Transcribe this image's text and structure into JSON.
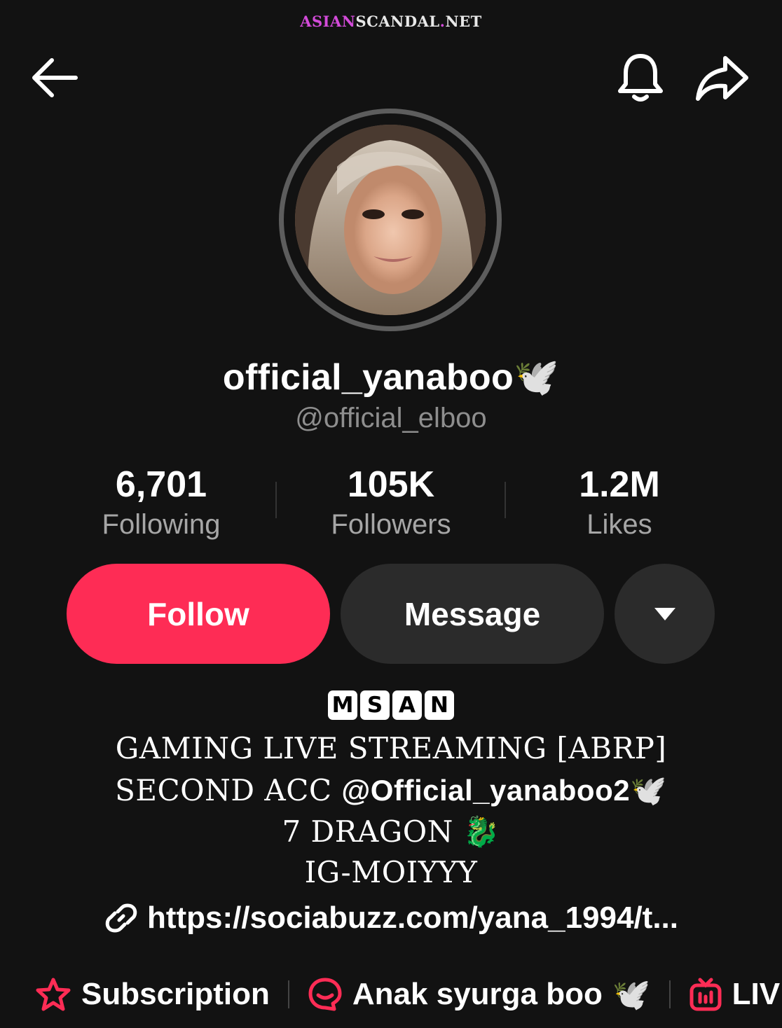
{
  "watermark": {
    "part1": "ASIAN",
    "part2": "SCANDAL",
    "dot": ".",
    "part3": "NET"
  },
  "header": {
    "icons": [
      "back-arrow-icon",
      "bell-icon",
      "share-icon"
    ]
  },
  "profile": {
    "display_name": "official_yanaboo",
    "display_emoji": "🕊️",
    "username": "@official_elboo"
  },
  "stats": [
    {
      "value": "6,701",
      "label": "Following"
    },
    {
      "value": "105K",
      "label": "Followers"
    },
    {
      "value": "1.2M",
      "label": "Likes"
    }
  ],
  "actions": {
    "follow": "Follow",
    "message": "Message",
    "more_icon": "caret-down-icon"
  },
  "colors": {
    "accent": "#fe2c55",
    "background": "#121212",
    "button_dark": "#2b2b2b"
  },
  "bio": {
    "tag_letters": [
      "M",
      "S",
      "A",
      "N"
    ],
    "line1": "GAMING LIVE STREAMING [ABRP]",
    "line2_prefix": "SECOND ACC ",
    "line2_mention": "@Official_yanaboo2",
    "line2_emoji": "🕊️",
    "line3": "7 DRAGON",
    "line3_emoji": "🐉",
    "line4": "IG-MOIYYY"
  },
  "link": {
    "icon": "link-icon",
    "text": "https://sociabuzz.com/yana_1994/t..."
  },
  "bottom": {
    "subscription": "Subscription",
    "group": "Anak syurga boo",
    "group_emoji": "🕊️",
    "live": "LIV"
  }
}
